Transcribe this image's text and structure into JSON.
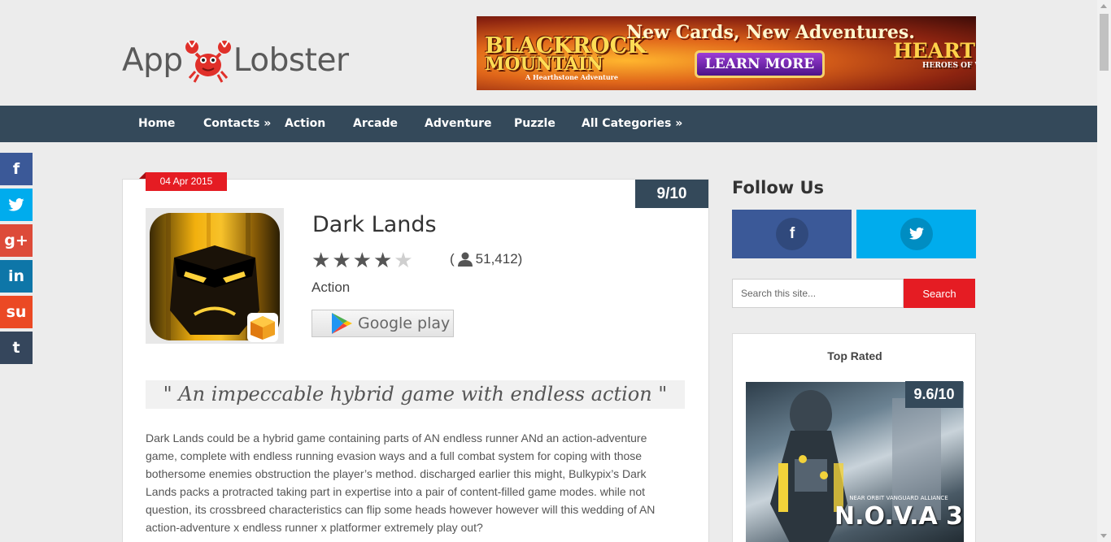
{
  "logo": {
    "left": "App",
    "right": "Lobster",
    "icon": "lobster-icon"
  },
  "banner": {
    "line1": "BLACKROCK",
    "line2": "MOUNTAIN",
    "line3": "A Hearthstone Adventure",
    "headline": "New Cards, New Adventures.",
    "cta": "LEARN MORE",
    "brand": "HEARTH",
    "brand_sub": "HEROES OF W"
  },
  "nav": {
    "items": [
      {
        "label": "Home"
      },
      {
        "label": "Contacts »"
      },
      {
        "label": "Action"
      },
      {
        "label": "Arcade"
      },
      {
        "label": "Adventure"
      },
      {
        "label": "Puzzle"
      },
      {
        "label": "All Categories »"
      }
    ]
  },
  "share": {
    "items": [
      {
        "name": "facebook",
        "glyph": "f",
        "color": "#3b5998"
      },
      {
        "name": "twitter",
        "glyph": "🐦",
        "color": "#00aced"
      },
      {
        "name": "google-plus",
        "glyph": "g+",
        "color": "#dd4b39"
      },
      {
        "name": "linkedin",
        "glyph": "in",
        "color": "#0e76a8"
      },
      {
        "name": "stumbleupon",
        "glyph": "su",
        "color": "#eb4924"
      },
      {
        "name": "tumblr",
        "glyph": "t",
        "color": "#35465c"
      }
    ]
  },
  "post": {
    "date": "04 Apr 2015",
    "score": "9/10",
    "title": "Dark Lands",
    "rating_stars": 4,
    "rating_max": 5,
    "votes_open": "(",
    "votes": "51,412)",
    "category": "Action",
    "store_label": "Google play",
    "quote": "\" An impeccable hybrid game with endless action \"",
    "body": "Dark Lands could be a hybrid game containing parts of AN endless runner ANd an action-adventure game, complete with endless running evasion ways and a full combat system for coping with those bothersome enemies obstruction the player’s method. discharged earlier this might, Bulkypix’s Dark Lands packs a protracted taking part in expertise into a pair of content-filled game modes. while not question, its crossbreed characteristics can flip some heads however however will this wedding of AN action-adventure x endless runner x platformer extremely play out?"
  },
  "sidebar": {
    "follow_title": "Follow Us",
    "facebook_glyph": "f",
    "twitter_glyph": "🐦",
    "search_placeholder": "Search this site...",
    "search_button": "Search",
    "top_rated_title": "Top Rated",
    "top_rated_score": "9.6/10",
    "top_rated_game_sub": "NEAR ORBIT VANGUARD ALLIANCE",
    "top_rated_game": "N.O.V.A 3"
  },
  "colors": {
    "nav": "#34495a",
    "accent": "#e51c23"
  }
}
